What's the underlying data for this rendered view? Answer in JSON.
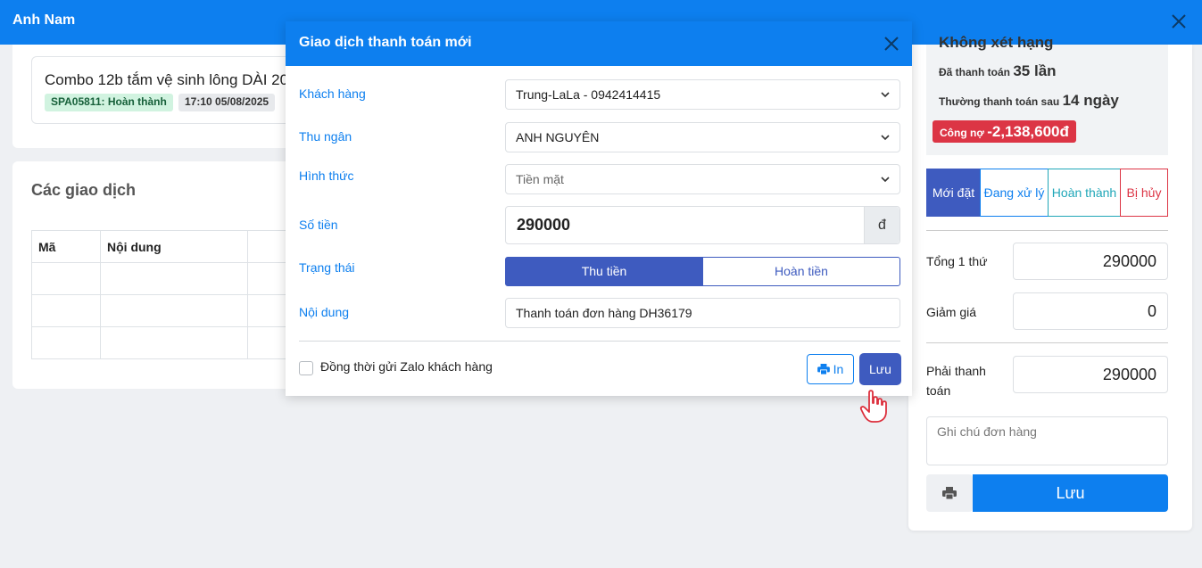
{
  "topbar": {
    "title": "Anh Nam"
  },
  "product": {
    "name": "Combo 12b tắm vệ sinh lông DÀI 20",
    "status_tag": "SPA05811: Hoàn thành",
    "time_tag": "17:10 05/08/2025"
  },
  "transactions": {
    "heading": "Các giao dịch",
    "columns": [
      "Mã",
      "Nội dung",
      ""
    ]
  },
  "rank": {
    "title": "Không xét hạng",
    "paid_label": "Đã thanh toán",
    "paid_value": "35 lần",
    "cycle_label": "Thường thanh toán sau",
    "cycle_value": "14 ngày",
    "debt_label": "Công nợ",
    "debt_value": "-2,138,600đ"
  },
  "order_status_tabs": [
    "Mới đặt",
    "Đang xử lý",
    "Hoàn thành",
    "Bị hủy"
  ],
  "totals": {
    "subtotal_label": "Tổng 1 thứ",
    "subtotal_value": "290000",
    "discount_label": "Giảm giá",
    "discount_value": "0",
    "payable_label": "Phải thanh toán",
    "payable_value": "290000",
    "note_placeholder": "Ghi chú đơn hàng",
    "save_label": "Lưu"
  },
  "modal": {
    "title": "Giao dịch thanh toán mới",
    "fields": {
      "customer_label": "Khách hàng",
      "customer_value": "Trung-LaLa - 0942414415",
      "cashier_label": "Thu ngân",
      "cashier_value": "ANH NGUYÊN",
      "method_label": "Hình thức",
      "method_value": "Tiền mặt",
      "amount_label": "Số tiền",
      "amount_value": "290000",
      "amount_unit": "đ",
      "status_label": "Trạng thái",
      "status_on": "Thu tiền",
      "status_off": "Hoàn tiền",
      "content_label": "Nội dung",
      "content_value": "Thanh toán đơn hàng DH36179"
    },
    "zalo_label": "Đồng thời gửi Zalo khách hàng",
    "print_label": "In",
    "save_label": "Lưu"
  },
  "colors": {
    "primary": "#0d7fef",
    "indigo": "#3e5bbf",
    "danger": "#dc3545",
    "teal": "#20a7b8"
  }
}
